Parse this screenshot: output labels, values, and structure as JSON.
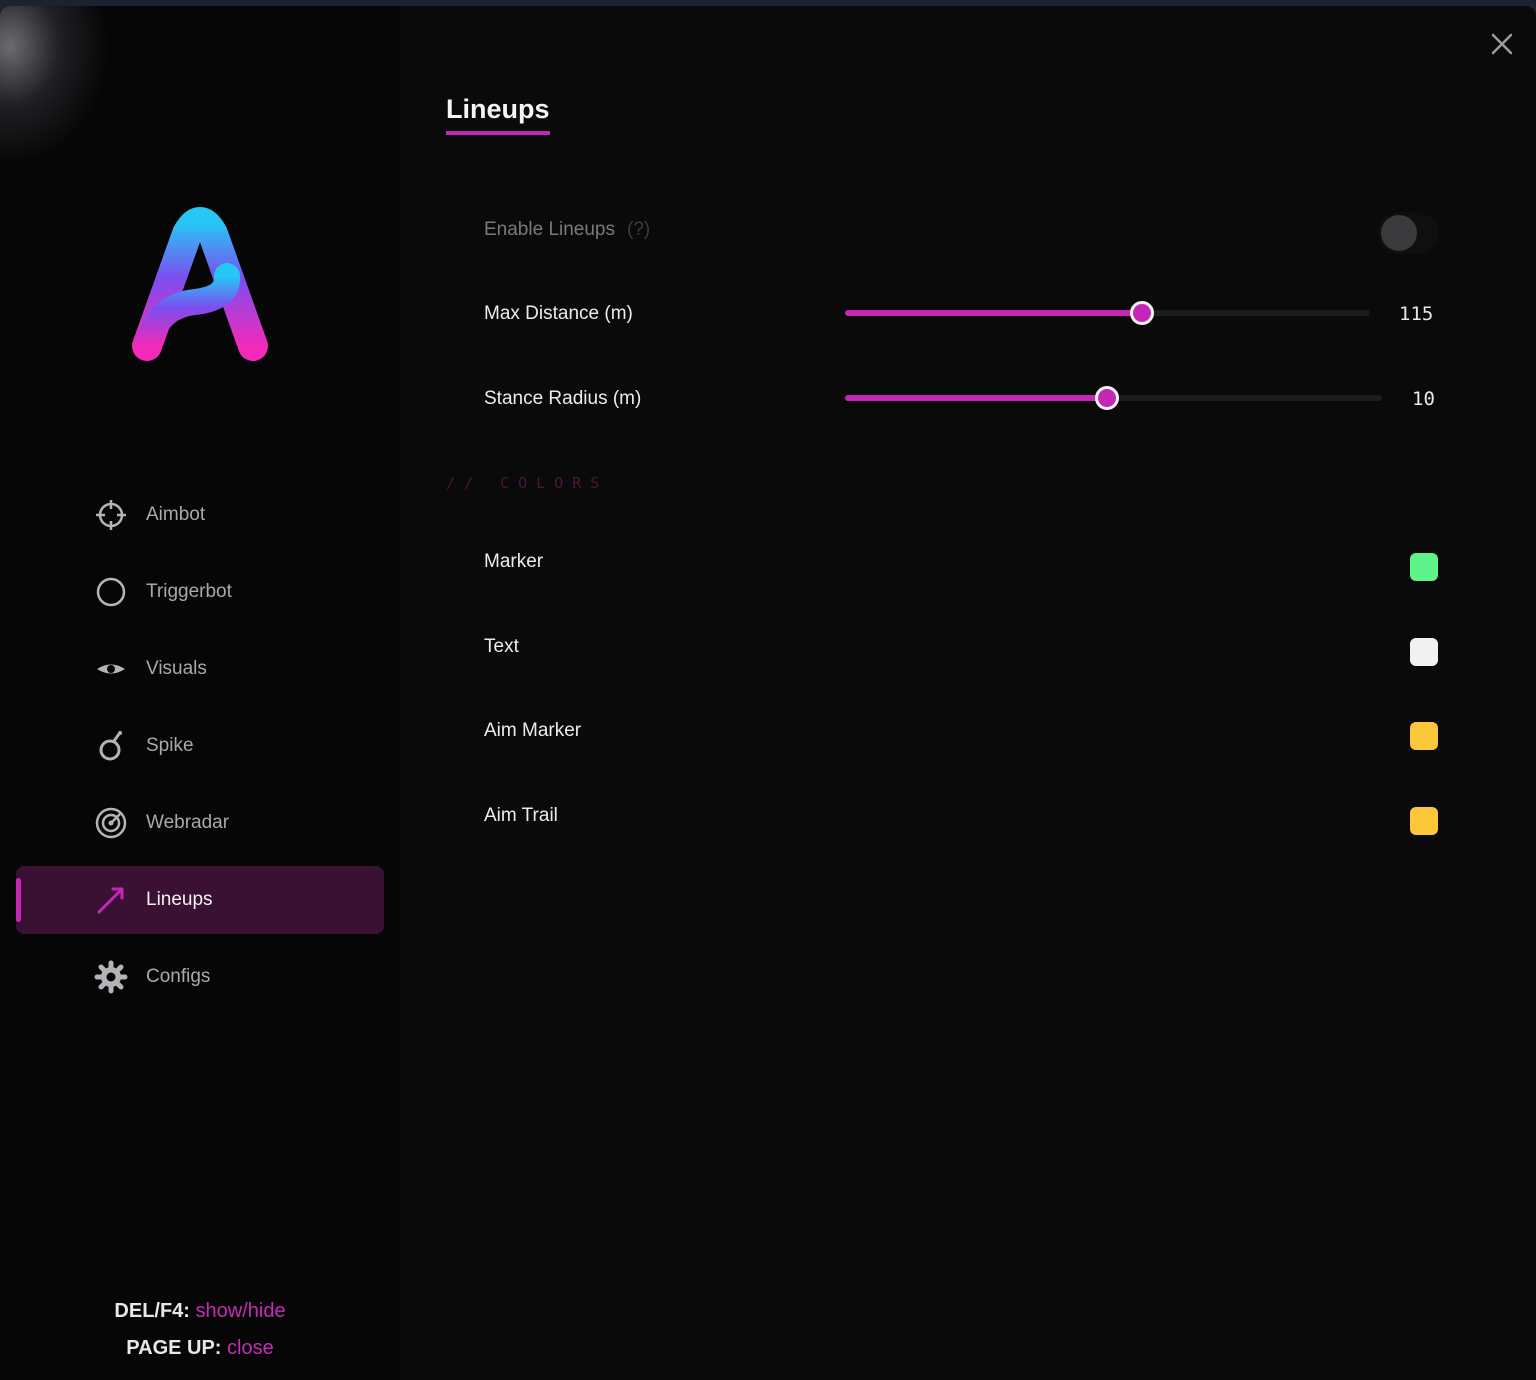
{
  "window": {
    "close_icon": "close-icon"
  },
  "sidebar": {
    "logo_icon": "app-logo",
    "items": [
      {
        "label": "Aimbot",
        "icon": "crosshair-icon",
        "active": false
      },
      {
        "label": "Triggerbot",
        "icon": "circle-icon",
        "active": false
      },
      {
        "label": "Visuals",
        "icon": "eye-icon",
        "active": false
      },
      {
        "label": "Spike",
        "icon": "bomb-icon",
        "active": false
      },
      {
        "label": "Webradar",
        "icon": "radar-icon",
        "active": false
      },
      {
        "label": "Lineups",
        "icon": "line-arrow-icon",
        "active": true
      },
      {
        "label": "Configs",
        "icon": "gear-icon",
        "active": false
      }
    ],
    "hotkeys": [
      {
        "key": "DEL/F4:",
        "action": "show/hide"
      },
      {
        "key": "PAGE UP:",
        "action": "close"
      }
    ]
  },
  "main": {
    "title": "Lineups",
    "enable": {
      "label": "Enable Lineups",
      "help": "(?)",
      "enabled": false
    },
    "sliders": [
      {
        "label": "Max Distance (m)",
        "value": "115",
        "fraction": 0.565
      },
      {
        "label": "Stance Radius (m)",
        "value": "10",
        "fraction": 0.487
      }
    ],
    "colors_header": "// COLORS",
    "colors": [
      {
        "label": "Marker",
        "color": "#5df58a"
      },
      {
        "label": "Text",
        "color": "#f1f1f4"
      },
      {
        "label": "Aim Marker",
        "color": "#fcc83a"
      },
      {
        "label": "Aim Trail",
        "color": "#fcc83a"
      }
    ]
  },
  "theme": {
    "accent": "#c426b5",
    "background": "#0a0a0b"
  }
}
